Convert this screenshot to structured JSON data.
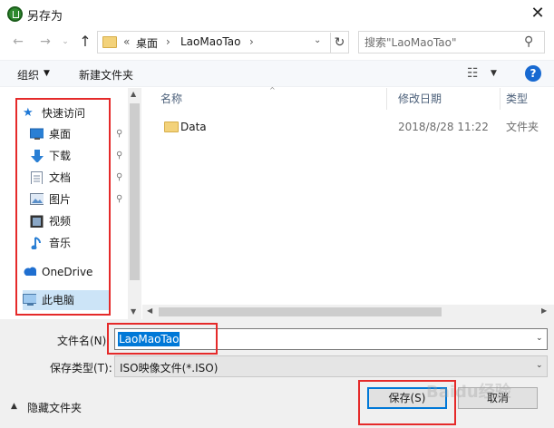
{
  "window": {
    "title": "另存为",
    "close_glyph": "✕"
  },
  "nav": {
    "back": "←",
    "forward": "→",
    "history": "⌄",
    "up": "↑",
    "breadcrumb": [
      "桌面",
      "LaoMaoTao"
    ],
    "overflow": "«",
    "separator": "›",
    "dropdown": "⌄",
    "refresh": "↻"
  },
  "search": {
    "placeholder": "搜索\"LaoMaoTao\"",
    "icon": "⚲"
  },
  "toolbar": {
    "organize": "组织",
    "organize_caret": "▼",
    "new_folder": "新建文件夹",
    "view_icon": "☷",
    "view_caret": "▼",
    "help": "?"
  },
  "sidebar": {
    "quick_access": "快速访问",
    "quick_access_icon": "★",
    "items": [
      {
        "label": "桌面",
        "icon": "desktop-icon",
        "pinned": true
      },
      {
        "label": "下载",
        "icon": "download-icon",
        "pinned": true
      },
      {
        "label": "文档",
        "icon": "document-icon",
        "pinned": true
      },
      {
        "label": "图片",
        "icon": "picture-icon",
        "pinned": true
      },
      {
        "label": "视频",
        "icon": "video-icon",
        "pinned": false
      },
      {
        "label": "音乐",
        "icon": "music-icon",
        "pinned": false
      }
    ],
    "onedrive": "OneDrive",
    "this_pc": "此电脑",
    "pin_glyph": "📌",
    "scroll_up": "▲",
    "scroll_down": "▼"
  },
  "file_list": {
    "columns": [
      "名称",
      "修改日期",
      "类型"
    ],
    "sort_caret": "^",
    "rows": [
      {
        "name": "Data",
        "modified": "2018/8/28 11:22",
        "type": "文件夹"
      }
    ],
    "scroll_left": "◀",
    "scroll_right": "▶"
  },
  "form": {
    "filename_label": "文件名(N):",
    "filename_value": "LaoMaoTao",
    "filetype_label": "保存类型(T):",
    "filetype_value": "ISO映像文件(*.ISO)",
    "caret": "⌄",
    "hide_folders": "隐藏文件夹",
    "hide_caret": "▲",
    "save": "保存(S)",
    "cancel": "取消"
  },
  "watermark": "Baidu经验",
  "colors": {
    "accent": "#0078d7",
    "annotation": "#e52a2a",
    "selection": "#cce4f7"
  }
}
